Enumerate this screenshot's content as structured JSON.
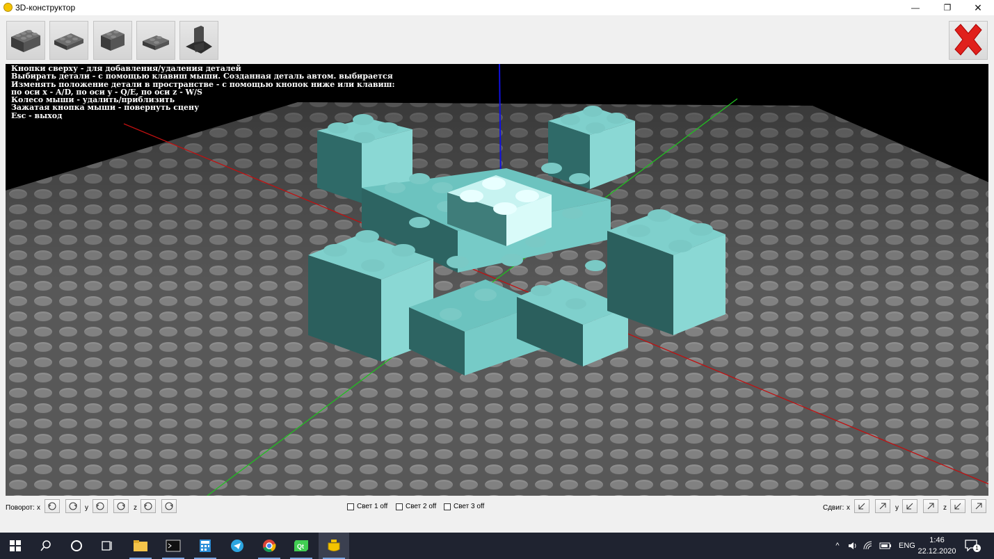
{
  "window": {
    "title": "3D-конструктор",
    "minimize_glyph": "—",
    "maximize_glyph": "❐",
    "close_glyph": "✕"
  },
  "toolbar": {
    "parts": [
      {
        "name": "brick-2x4-icon"
      },
      {
        "name": "plate-2x4-icon"
      },
      {
        "name": "brick-2x2-icon"
      },
      {
        "name": "plate-2x2-icon"
      },
      {
        "name": "slope-brick-icon"
      }
    ],
    "close_button": "red-x-icon"
  },
  "help_text": [
    "Кнопки сверху - для добавления/удаления деталей",
    "Выбирать детали - с помощью клавиш мыши. Созданная деталь автом. выбирается",
    "Изменять положение детали в пространстве - с помощью кнопок ниже или клавиш:",
    "по оси x - A/D, по оси y - Q/E, по оси z - W/S",
    "Колесо мыши - удалить/приблизить",
    "Зажатая кнопка мыши - повернуть сцену",
    "Esc - выход"
  ],
  "scene": {
    "background": "#000000",
    "floor_color": "#5a5a5a",
    "stud_color": "#8a8a8a",
    "brick_color": "#5fb8b4",
    "axis_x_color": "#c01010",
    "axis_y_color": "#20c020",
    "axis_z_color": "#1010e0"
  },
  "controls": {
    "rotate_label": "Поворот:",
    "x_label": "x",
    "y_label": "y",
    "z_label": "z",
    "lights": [
      {
        "label": "Свет 1 off",
        "checked": false
      },
      {
        "label": "Свет 2 off",
        "checked": false
      },
      {
        "label": "Свет 3 off",
        "checked": false
      }
    ],
    "shift_label": "Сдвиг:"
  },
  "taskbar": {
    "apps": [
      "start",
      "search",
      "cortana",
      "task-view",
      "file-explorer",
      "terminal",
      "calculator",
      "telegram",
      "chrome",
      "qt-creator",
      "3d-constructor"
    ],
    "language": "ENG",
    "time": "1:46",
    "date": "22.12.2020",
    "notification_count": "1"
  }
}
